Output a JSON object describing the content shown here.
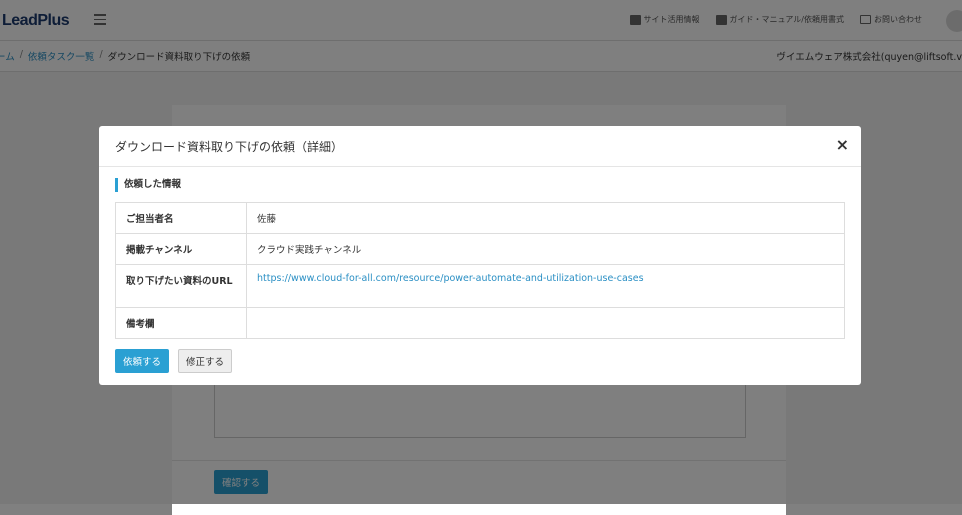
{
  "header": {
    "logo": "LeadPlus",
    "nav": [
      {
        "label": "サイト活用情報",
        "icon": "briefcase-icon"
      },
      {
        "label": "ガイド・マニュアル/依頼用書式",
        "icon": "book-icon"
      },
      {
        "label": "お問い合わせ",
        "icon": "mail-icon"
      }
    ]
  },
  "breadcrumb": {
    "home": "ーム",
    "tasks": "依頼タスク一覧",
    "current": "ダウンロード資料取り下げの依頼",
    "sep": "/"
  },
  "user_info": "ヴイエムウェア株式会社(quyen@liftsoft.v",
  "background_card": {
    "confirm_label": "確認する"
  },
  "modal": {
    "title": "ダウンロード資料取り下げの依頼（詳細）",
    "close": "×",
    "section_title": "依頼した情報",
    "rows": [
      {
        "label": "ご担当者名",
        "value": "佐藤"
      },
      {
        "label": "掲載チャンネル",
        "value": "クラウド実践チャンネル"
      },
      {
        "label": "取り下げたい資料のURL",
        "value": "https://www.cloud-for-all.com/resource/power-automate-and-utilization-use-cases"
      },
      {
        "label": "備考欄",
        "value": ""
      }
    ],
    "submit_label": "依頼する",
    "edit_label": "修正する"
  },
  "colors": {
    "accent": "#2aa0d3",
    "link": "#2a8fc4"
  }
}
